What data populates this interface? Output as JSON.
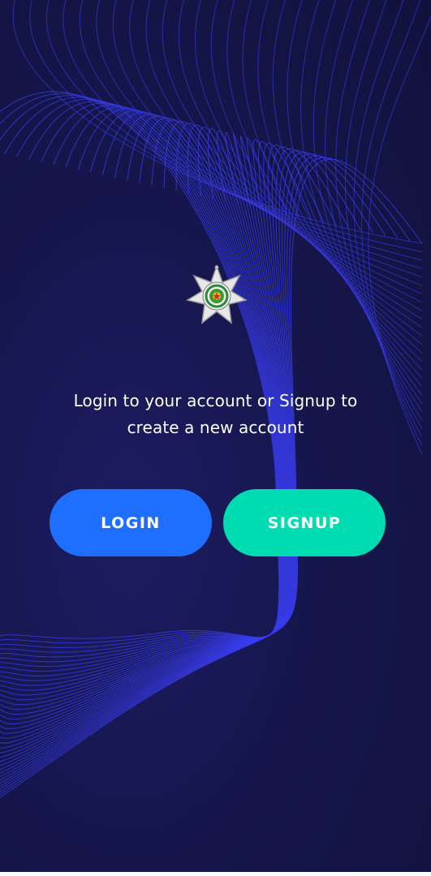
{
  "intro": {
    "line1": "Login to your account or Signup to",
    "line2": "create a new account"
  },
  "buttons": {
    "login_label": "LOGIN",
    "signup_label": "SIGNUP"
  },
  "icons": {
    "logo": "star-badge-emblem-icon"
  },
  "colors": {
    "background": "#15154a",
    "wave_lines": "#3a3df0",
    "login_button": "#1e6fff",
    "signup_button": "#00dcb2",
    "text": "#ffffff"
  }
}
